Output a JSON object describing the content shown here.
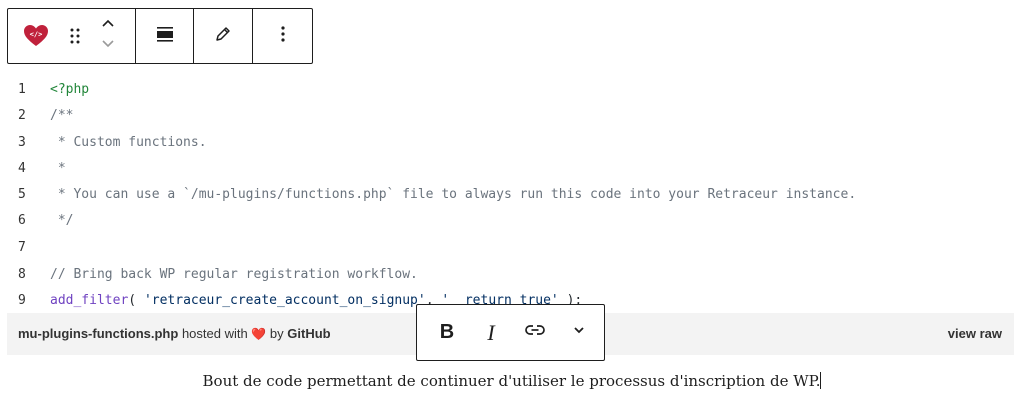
{
  "toolbar": {
    "block_icon": "gist-heart-icon",
    "drag_icon": "drag-handle-icon",
    "move_up_icon": "chevron-up-icon",
    "move_down_icon": "chevron-down-icon",
    "align_icon": "align-icon",
    "edit_icon": "pencil-icon",
    "more_icon": "more-vertical-icon",
    "accent": "#c0213b"
  },
  "code": {
    "lines": [
      {
        "n": "1",
        "parts": [
          {
            "t": "<?php",
            "c": "php"
          }
        ]
      },
      {
        "n": "2",
        "parts": [
          {
            "t": "/**",
            "c": "comment"
          }
        ]
      },
      {
        "n": "3",
        "parts": [
          {
            "t": " * Custom functions.",
            "c": "comment"
          }
        ]
      },
      {
        "n": "4",
        "parts": [
          {
            "t": " *",
            "c": "comment"
          }
        ]
      },
      {
        "n": "5",
        "parts": [
          {
            "t": " * You can use a `/mu-plugins/functions.php` file to always run this code into your Retraceur instance.",
            "c": "comment"
          }
        ]
      },
      {
        "n": "6",
        "parts": [
          {
            "t": " */",
            "c": "comment"
          }
        ]
      },
      {
        "n": "7",
        "parts": [
          {
            "t": "",
            "c": "plain"
          }
        ]
      },
      {
        "n": "8",
        "parts": [
          {
            "t": "// Bring back WP regular registration workflow.",
            "c": "comment"
          }
        ]
      },
      {
        "n": "9",
        "parts": [
          {
            "t": "add_filter",
            "c": "fn"
          },
          {
            "t": "( ",
            "c": "plain"
          },
          {
            "t": "'retraceur_create_account_on_signup'",
            "c": "str"
          },
          {
            "t": ", ",
            "c": "plain"
          },
          {
            "t": "'__return_true'",
            "c": "str"
          },
          {
            "t": " );",
            "c": "plain"
          }
        ]
      }
    ]
  },
  "footer": {
    "filename": "mu-plugins-functions.php",
    "hosted_with": "hosted with",
    "heart": "❤️",
    "by": "by",
    "host": "GitHub",
    "view_raw": "view raw"
  },
  "format_toolbar": {
    "bold_label": "B",
    "italic_label": "I",
    "link_icon": "link-icon",
    "more_icon": "chevron-down-icon"
  },
  "caption": {
    "text": "Bout de code permettant de continuer d'utiliser le processus d'inscription de WP."
  }
}
